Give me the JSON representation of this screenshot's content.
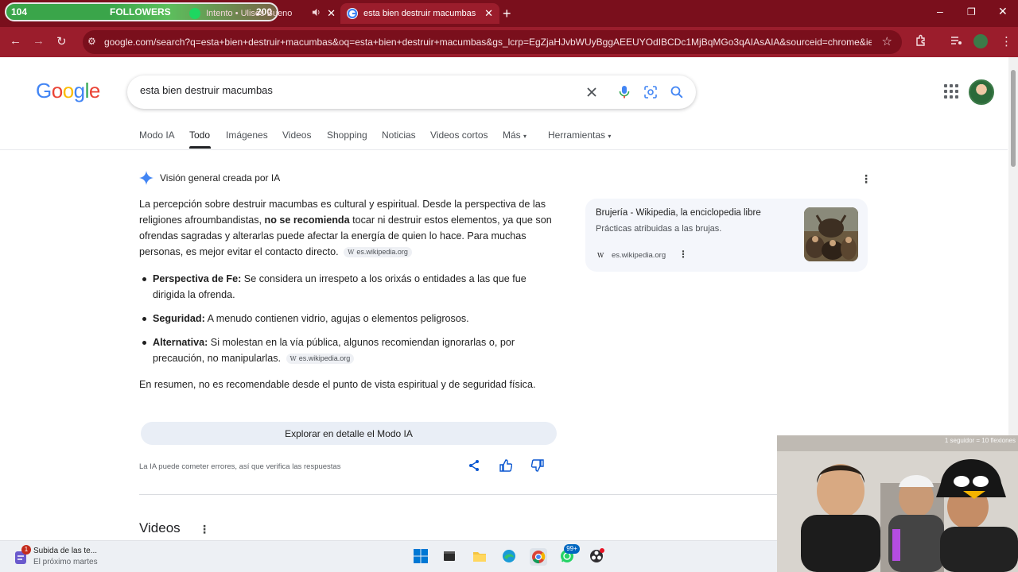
{
  "browser": {
    "tabs": [
      {
        "title": "Intento • Ulises Bueno",
        "audio": "speaker-icon",
        "active": false
      },
      {
        "title": "esta bien destruir macumbas - Buscar con Google",
        "active": true
      }
    ],
    "url": "google.com/search?q=esta+bien+destruir+macumbas&oq=esta+bien+destruir+macumbas&gs_lcrp=EgZjaHJvbWUyBggAEEUYOdIBCDc1MjBqMGo3qAIAsAIA&sourceid=chrome&ie=U...",
    "theme": {
      "frame": "#7a0f1c",
      "toolbar": "#9b1d2c"
    }
  },
  "overlay": {
    "followers_count": "104",
    "followers_label": "FOLLOWERS",
    "followers_goal": "200",
    "webcam_label": "1 seguidor = 10 flexiones"
  },
  "google": {
    "logo": "Google",
    "query": "esta bien destruir macumbas",
    "nav": [
      "Modo IA",
      "Todo",
      "Imágenes",
      "Videos",
      "Shopping",
      "Noticias",
      "Videos cortos",
      "Más",
      "Herramientas"
    ],
    "ai_overview": {
      "header": "Visión general creada por IA",
      "para1_a": "La percepción sobre destruir macumbas es cultural y espiritual. Desde la perspectiva de las religiones afroumbandistas, ",
      "para1_b": "no se recomienda",
      "para1_c": " tocar ni destruir estos elementos, ya que son ofrendas sagradas y alterarlas puede afectar la energía de quien lo hace. Para muchas personas, es mejor evitar el contacto directo.",
      "chip": "es.wikipedia.org",
      "chip_glyph": "W",
      "bullets": [
        {
          "term": "Perspectiva de Fe:",
          "text": " Se considera un irrespeto a los orixás o entidades a las que fue dirigida la ofrenda."
        },
        {
          "term": "Seguridad:",
          "text": " A menudo contienen vidrio, agujas o elementos peligrosos."
        },
        {
          "term": "Alternativa:",
          "text": " Si molestan en la vía pública, algunos recomiendan ignorarlas o, por precaución, no manipularlas."
        }
      ],
      "summary": "En resumen, no es recomendable desde el punto de vista espiritual y de seguridad física.",
      "explore_button": "Explorar en detalle el Modo IA",
      "disclaimer": "La IA puede cometer errores, así que verifica las respuestas"
    },
    "source_card": {
      "title": "Brujería - Wikipedia, la enciclopedia libre",
      "snippet": "Prácticas atribuidas a las brujas.",
      "domain": "es.wikipedia.org",
      "glyph": "W"
    },
    "videos_heading": "Videos"
  },
  "taskbar": {
    "notification_title": "Subida de las te...",
    "notification_sub": "El próximo martes",
    "notification_badge": "1",
    "whatsapp_badge": "99+"
  }
}
